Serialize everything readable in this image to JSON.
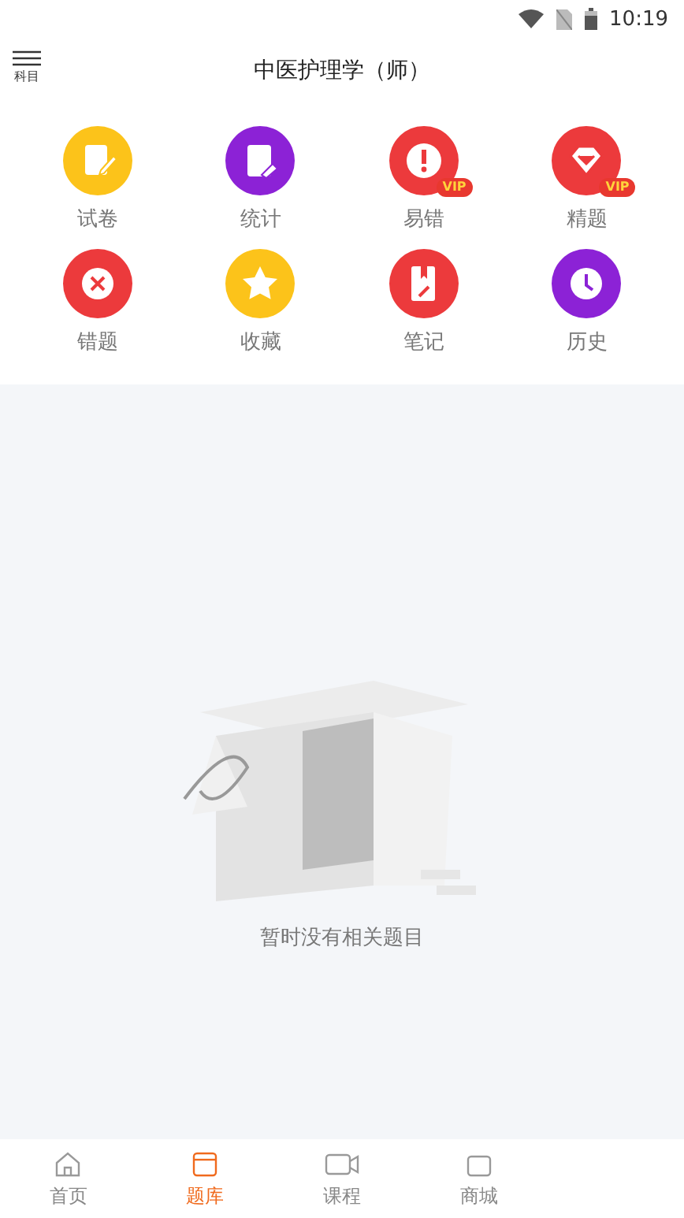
{
  "status_bar": {
    "time": "10:19"
  },
  "header": {
    "menu_label": "科目",
    "title": "中医护理学（师）"
  },
  "features": [
    {
      "label": "试卷",
      "kind": "paper",
      "color": "#fcc31a"
    },
    {
      "label": "统计",
      "kind": "stats",
      "color": "#8c22d6"
    },
    {
      "label": "易错",
      "kind": "alert",
      "color": "#ec3a3c",
      "badge": "VIP"
    },
    {
      "label": "精题",
      "kind": "diamond",
      "color": "#ec3a3c",
      "badge": "VIP"
    },
    {
      "label": "错题",
      "kind": "wrong",
      "color": "#ec3a3c"
    },
    {
      "label": "收藏",
      "kind": "star",
      "color": "#fcc31a"
    },
    {
      "label": "笔记",
      "kind": "note",
      "color": "#ec3a3c"
    },
    {
      "label": "历史",
      "kind": "clock",
      "color": "#8c22d6"
    }
  ],
  "empty_state": {
    "message": "暂时没有相关题目"
  },
  "tab_bar": [
    {
      "label": "首页",
      "kind": "home",
      "selected": false
    },
    {
      "label": "题库",
      "kind": "bank",
      "selected": true
    },
    {
      "label": "课程",
      "kind": "video",
      "selected": false
    },
    {
      "label": "商城",
      "kind": "shop",
      "selected": false
    }
  ]
}
